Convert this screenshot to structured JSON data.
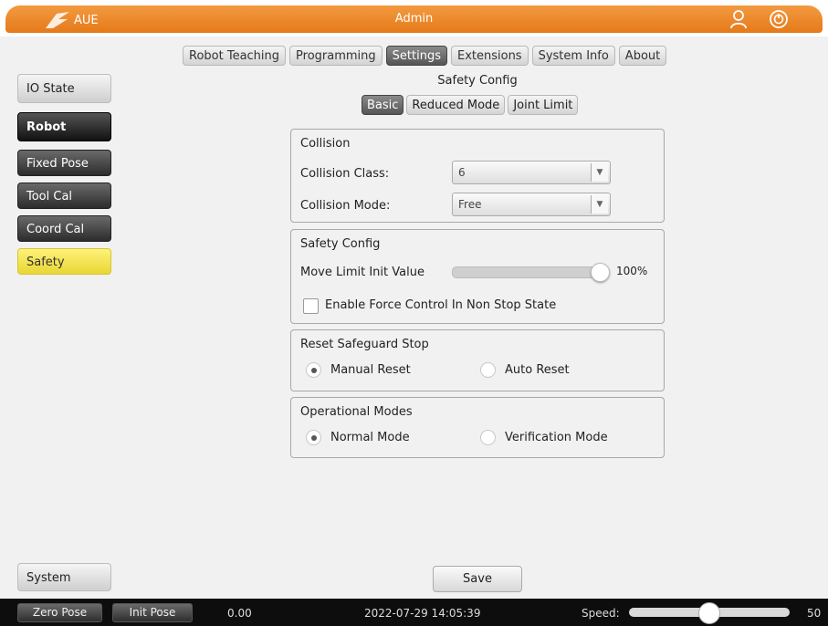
{
  "titlebar": {
    "logo_text": "AUE",
    "title": "Admin"
  },
  "top_tabs": [
    {
      "label": "Robot Teaching",
      "active": false
    },
    {
      "label": "Programming",
      "active": false
    },
    {
      "label": "Settings",
      "active": true
    },
    {
      "label": "Extensions",
      "active": false
    },
    {
      "label": "System Info",
      "active": false
    },
    {
      "label": "About",
      "active": false
    }
  ],
  "sidebar": {
    "io_state": "IO State",
    "robot": "Robot",
    "items": [
      "Fixed Pose",
      "Tool Cal",
      "Coord Cal",
      "Safety"
    ],
    "system": "System"
  },
  "section_title": "Safety Config",
  "sub_tabs": [
    {
      "label": "Basic",
      "active": true
    },
    {
      "label": "Reduced Mode",
      "active": false
    },
    {
      "label": "Joint Limit",
      "active": false
    }
  ],
  "collision": {
    "title": "Collision",
    "class_label": "Collision Class:",
    "class_value": "6",
    "mode_label": "Collision Mode:",
    "mode_value": "Free"
  },
  "safety_config": {
    "title": "Safety Config",
    "move_limit_label": "Move Limit Init Value",
    "move_limit_value": "100%",
    "move_limit_fraction": 1.0,
    "force_control_label": "Enable Force Control In Non Stop State",
    "force_control_checked": false
  },
  "reset_safeguard": {
    "title": "Reset Safeguard Stop",
    "manual_label": "Manual Reset",
    "auto_label": "Auto Reset",
    "selected": "manual"
  },
  "operational_modes": {
    "title": "Operational Modes",
    "normal_label": "Normal Mode",
    "verification_label": "Verification Mode",
    "selected": "normal"
  },
  "save_label": "Save",
  "statusbar": {
    "zero_pose": "Zero Pose",
    "init_pose": "Init Pose",
    "value": "0.00",
    "datetime": "2022-07-29 14:05:39",
    "speed_label": "Speed:",
    "speed_value": "50",
    "speed_fraction": 0.5
  },
  "colors": {
    "title_orange": "#e8821f",
    "safety_yellow": "#f2e04a"
  }
}
